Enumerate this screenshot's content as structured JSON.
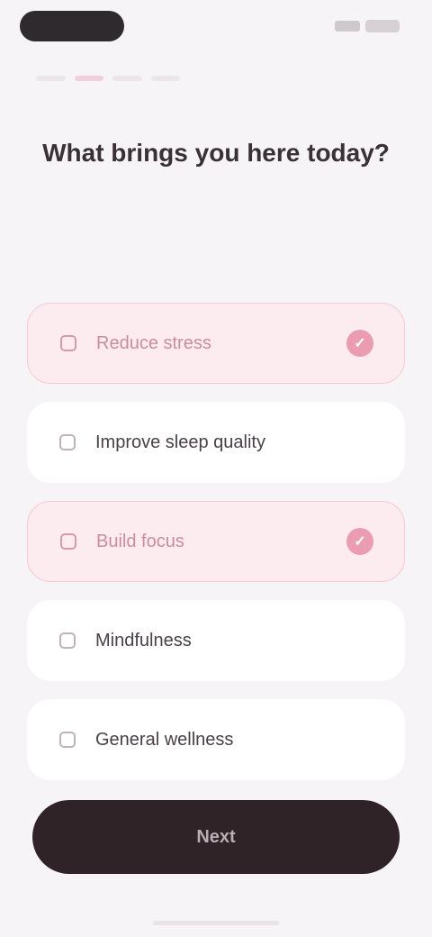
{
  "status_bar": {
    "time_pill": "",
    "icons": [
      "signal-icon",
      "battery-icon"
    ]
  },
  "progress": {
    "steps": 4,
    "active_index": 1
  },
  "question": "What brings you here today?",
  "subtitle": "",
  "options": [
    {
      "label": "Reduce stress",
      "selected": true
    },
    {
      "label": "Improve sleep quality",
      "selected": false
    },
    {
      "label": "Build focus",
      "selected": true
    },
    {
      "label": "Mindfulness",
      "selected": false
    },
    {
      "label": "General wellness",
      "selected": false
    }
  ],
  "continue_label": "Next",
  "colors": {
    "accent": "#ea9db2",
    "selected_bg": "#fdecef",
    "button_bg": "#2f2327",
    "page_bg": "#f7f4f7"
  }
}
